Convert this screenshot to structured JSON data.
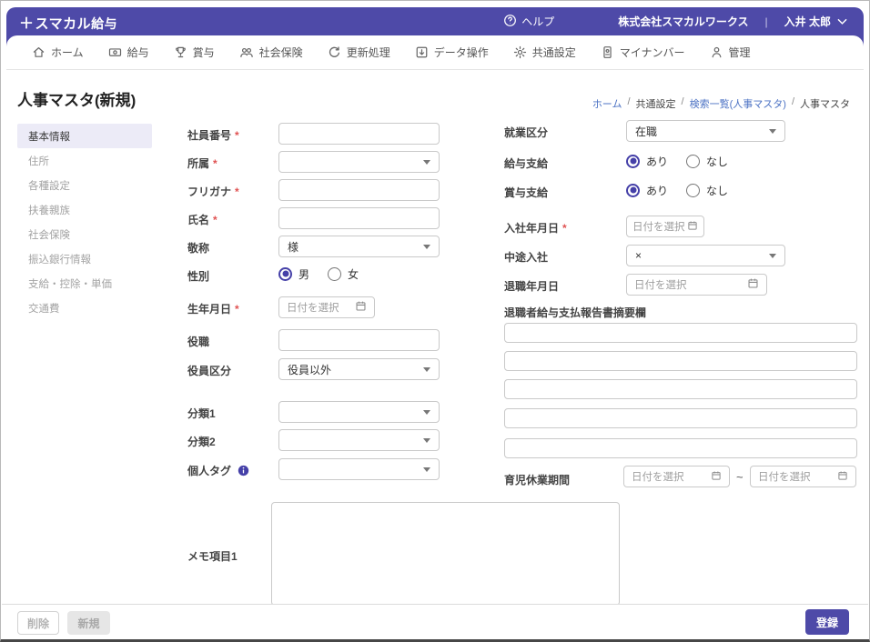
{
  "header": {
    "logo_plus": "＋",
    "logo_main": "スマカル",
    "logo_suffix": "給与",
    "help_label": "ヘルプ",
    "company_name": "株式会社スマカルワークス",
    "separator": "|",
    "user_name": "入井 太郎"
  },
  "nav": {
    "items": [
      {
        "label": "ホーム",
        "icon": "home-icon"
      },
      {
        "label": "給与",
        "icon": "payroll-icon"
      },
      {
        "label": "賞与",
        "icon": "bonus-trophy-icon"
      },
      {
        "label": "社会保険",
        "icon": "people-icon"
      },
      {
        "label": "更新処理",
        "icon": "refresh-icon"
      },
      {
        "label": "データ操作",
        "icon": "data-operation-icon"
      },
      {
        "label": "共通設定",
        "icon": "settings-gear-icon"
      },
      {
        "label": "マイナンバー",
        "icon": "id-card-icon"
      },
      {
        "label": "管理",
        "icon": "person-icon"
      }
    ]
  },
  "page": {
    "title": "人事マスタ(新規)",
    "breadcrumb_separator": "/",
    "breadcrumb": [
      {
        "label": "ホーム"
      },
      {
        "label": "共通設定"
      },
      {
        "label": "検索一覧(人事マスタ)"
      },
      {
        "label": "人事マスタ"
      }
    ]
  },
  "sidebar": {
    "active": "基本情報",
    "items": [
      {
        "label": "基本情報"
      },
      {
        "label": "住所"
      },
      {
        "label": "各種設定"
      },
      {
        "label": "扶養親族"
      },
      {
        "label": "社会保険"
      },
      {
        "label": "振込銀行情報"
      },
      {
        "label": "支給・控除・単価"
      },
      {
        "label": "交通費"
      }
    ]
  },
  "form": {
    "required_mark": "*",
    "left": {
      "employee_no_label": "社員番号",
      "department_label": "所属",
      "furigana_label": "フリガナ",
      "name_label": "氏名",
      "honorific_label": "敬称",
      "honorific_value": "様",
      "gender_label": "性別",
      "gender_options": [
        "男",
        "女"
      ],
      "gender_selected": "男",
      "birthdate_label": "生年月日",
      "date_placeholder": "日付を選択",
      "position_label": "役職",
      "officer_label": "役員区分",
      "officer_value": "役員以外",
      "category1_label": "分類1",
      "category2_label": "分類2",
      "personal_tag_label": "個人タグ",
      "memo1_label": "メモ項目1",
      "memo1_value": ""
    },
    "right": {
      "employment_label": "就業区分",
      "employment_value": "在職",
      "salary_label": "給与支給",
      "salary_options": [
        "あり",
        "なし"
      ],
      "salary_selected": "あり",
      "bonus_label": "賞与支給",
      "bonus_options": [
        "あり",
        "なし"
      ],
      "bonus_selected": "あり",
      "hire_date_label": "入社年月日",
      "date_placeholder": "日付を選択",
      "midcareer_label": "中途入社",
      "midcareer_value": "×",
      "retirement_date_label": "退職年月日",
      "retiree_report_label": "退職者給与支払報告書摘要欄",
      "retiree_report_rows": 5,
      "childcare_label": "育児休業期間",
      "range_tilde": "~"
    }
  },
  "footer": {
    "delete_label": "削除",
    "new_label": "新規",
    "register_label": "登録"
  },
  "colors": {
    "brand_purple": "#4e4aa8",
    "radio_active": "#4540a8",
    "link_blue": "#4d73c4",
    "required_red": "#e05252",
    "sidebar_active_bg": "#ecebf7"
  }
}
